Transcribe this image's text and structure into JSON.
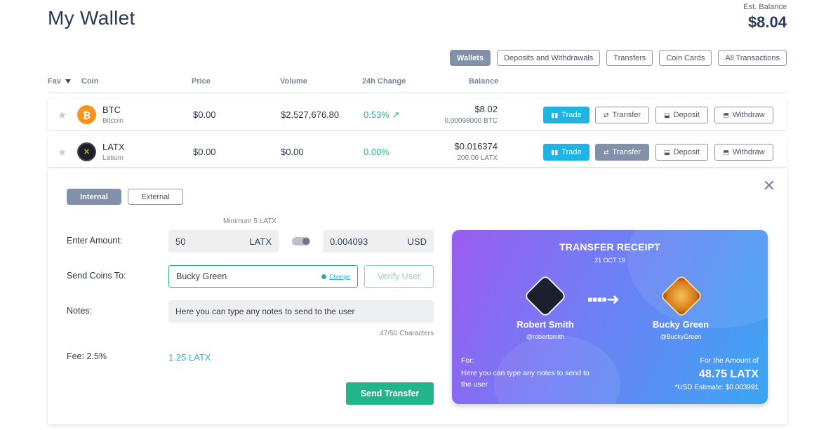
{
  "header": {
    "title": "My Wallet",
    "est_label": "Est. Balance",
    "est_value": "$8.04"
  },
  "tabs": [
    "Wallets",
    "Deposits and Withdrawals",
    "Transfers",
    "Coin Cards",
    "All Transactions"
  ],
  "table": {
    "headers": {
      "fav": "Fav",
      "coin": "Coin",
      "price": "Price",
      "volume": "Volume",
      "change": "24h Change",
      "balance": "Balance"
    },
    "rows": [
      {
        "symbol": "BTC",
        "name": "Bitcoin",
        "price": "$0.00",
        "volume": "$2,527,676.80",
        "change": "0.53%",
        "balance": "$8.02",
        "balance_sub": "0.00098000 BTC",
        "icon": "bitcoin-icon"
      },
      {
        "symbol": "LATX",
        "name": "Latium",
        "price": "$0.00",
        "volume": "$0.00",
        "change": "0.00%",
        "balance": "$0.016374",
        "balance_sub": "200.00 LATX",
        "icon": "latium-icon"
      }
    ],
    "actions": {
      "trade": "Trade",
      "transfer": "Transfer",
      "deposit": "Deposit",
      "withdraw": "Withdraw"
    }
  },
  "transfer": {
    "tab_internal": "Internal",
    "tab_external": "External",
    "min_note": "Minimum 5 LATX",
    "amount_label": "Enter Amount:",
    "amount_value": "50",
    "amount_unit": "LATX",
    "usd_value": "0.004093",
    "usd_unit": "USD",
    "sendto_label": "Send Coins To:",
    "sendto_value": "Bucky Green",
    "change_link": "Change",
    "verify_label": "Verify User",
    "notes_label": "Notes:",
    "notes_value": "Here you can type any notes to send to the user",
    "chars_note": "47/50 Characters",
    "fee_label": "Fee: 2.5%",
    "fee_value": "1.25 LATX",
    "send_label": "Send Transfer"
  },
  "receipt": {
    "title": "TRANSFER RECEIPT",
    "date": "21 OCT 19",
    "from_name": "Robert Smith",
    "from_handle": "@robertsmith",
    "to_name": "Bucky Green",
    "to_handle": "@BuckyGreen",
    "for_label": "For:",
    "note": "Here you can type any notes to send to the user",
    "amount_label": "For the Amount of",
    "amount": "48.75 LATX",
    "usd_estimate": "*USD Estimate: $0.003991"
  },
  "colors": {
    "accent_blue": "#1fb3e6",
    "accent_green": "#22b58c",
    "tab_active": "#8390a9",
    "title": "#2b3a55"
  }
}
